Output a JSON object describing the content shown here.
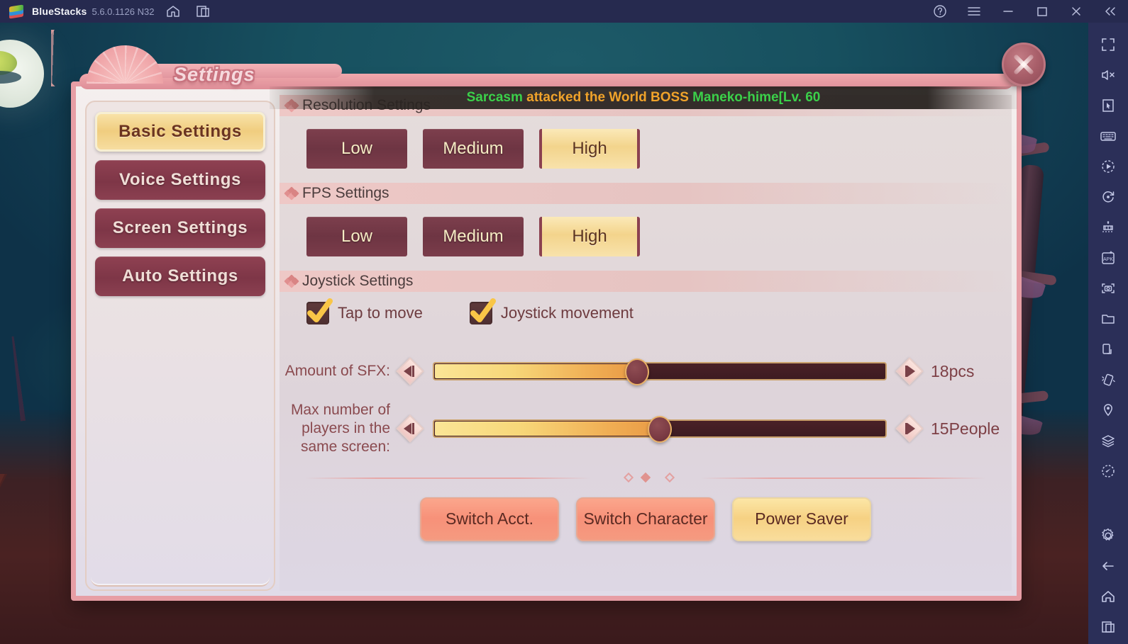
{
  "titlebar": {
    "app_name": "BlueStacks",
    "version": "5.6.0.1126 N32",
    "left_icons": [
      "home-icon",
      "multi-instance-icon"
    ],
    "right_icons": [
      "help-icon",
      "menu-icon",
      "minimize-icon",
      "maximize-icon",
      "close-icon",
      "collapse-icon"
    ]
  },
  "sidebar_rail": {
    "icons": [
      "fullscreen-icon",
      "mute-icon",
      "cursor-icon",
      "keyboard-icon",
      "macro-record-icon",
      "rotate-icon",
      "multi-instance-manager-icon",
      "install-apk-icon",
      "screenshot-icon",
      "media-folder-icon",
      "copy-to-phone-icon",
      "shake-icon",
      "location-icon",
      "layers-icon",
      "compass-icon",
      "gear-icon",
      "back-icon",
      "home-icon",
      "recents-icon"
    ]
  },
  "dialog": {
    "title": "Settings",
    "close_label": "close"
  },
  "banner": {
    "segments": [
      {
        "text": "Sarcasm",
        "color": "green"
      },
      {
        "text": " attacked the World BOSS ",
        "color": "orange"
      },
      {
        "text": "Maneko-hime[Lv. 60",
        "color": "green"
      }
    ],
    "full_text": "Sarcasm attacked the World BOSS Maneko-hime[Lv. 60"
  },
  "menu": {
    "items": [
      {
        "label": "Basic  Settings",
        "active": true
      },
      {
        "label": "Voice  Settings",
        "active": false
      },
      {
        "label": "Screen  Settings",
        "active": false
      },
      {
        "label": "Auto  Settings",
        "active": false
      }
    ]
  },
  "sections": {
    "resolution": {
      "title": "Resolution Settings",
      "options": [
        {
          "label": "Low",
          "selected": false
        },
        {
          "label": "Medium",
          "selected": false
        },
        {
          "label": "High",
          "selected": true
        }
      ]
    },
    "fps": {
      "title": "FPS Settings",
      "options": [
        {
          "label": "Low",
          "selected": false
        },
        {
          "label": "Medium",
          "selected": false
        },
        {
          "label": "High",
          "selected": true
        }
      ]
    },
    "joystick": {
      "title": "Joystick Settings",
      "checkboxes": [
        {
          "label": "Tap to move",
          "checked": true
        },
        {
          "label": "Joystick movement",
          "checked": true
        }
      ]
    }
  },
  "sliders": [
    {
      "label": "Amount of SFX:",
      "value_text": "18pcs",
      "percent": 45,
      "dec_label": "decrease",
      "inc_label": "increase"
    },
    {
      "label": "Max number of players in the same screen:",
      "value_text": "15People",
      "percent": 50,
      "dec_label": "decrease",
      "inc_label": "increase"
    }
  ],
  "actions": [
    {
      "label": "Switch Acct.",
      "style": "salmon"
    },
    {
      "label": "Switch Character",
      "style": "salmon"
    },
    {
      "label": "Power Saver",
      "style": "gold"
    }
  ],
  "colors": {
    "titlebar_bg": "#262a4f",
    "rail_bg": "#2b2f58",
    "dialog_border": "#e79ea5",
    "accent_gold": "#f3d48c",
    "accent_maroon": "#7e3647",
    "banner_green": "#3bd04a",
    "banner_orange": "#f0a32a"
  }
}
